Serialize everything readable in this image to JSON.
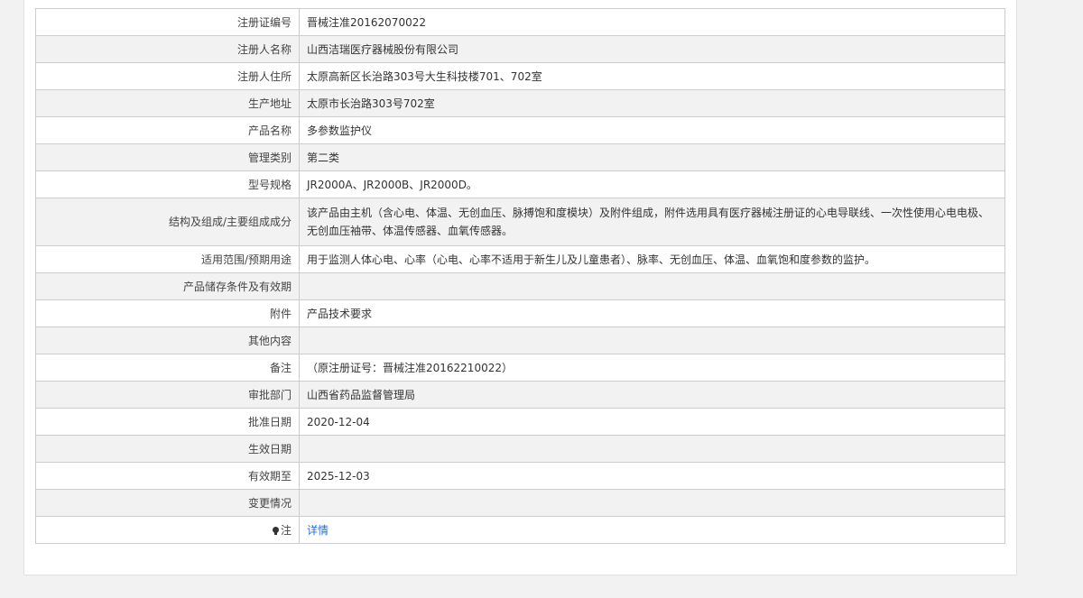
{
  "rows": [
    {
      "label": "注册证编号",
      "value": "晋械注准20162070022"
    },
    {
      "label": "注册人名称",
      "value": "山西洁瑞医疗器械股份有限公司"
    },
    {
      "label": "注册人住所",
      "value": "太原高新区长治路303号大生科技楼701、702室"
    },
    {
      "label": "生产地址",
      "value": "太原市长治路303号702室"
    },
    {
      "label": "产品名称",
      "value": "多参数监护仪"
    },
    {
      "label": "管理类别",
      "value": "第二类"
    },
    {
      "label": "型号规格",
      "value": "JR2000A、JR2000B、JR2000D。"
    },
    {
      "label": "结构及组成/主要组成成分",
      "value": "该产品由主机（含心电、体温、无创血压、脉搏饱和度模块）及附件组成，附件选用具有医疗器械注册证的心电导联线、一次性使用心电电极、无创血压袖带、体温传感器、血氧传感器。"
    },
    {
      "label": "适用范围/预期用途",
      "value": "用于监测人体心电、心率（心电、心率不适用于新生儿及儿童患者）、脉率、无创血压、体温、血氧饱和度参数的监护。"
    },
    {
      "label": "产品储存条件及有效期",
      "value": ""
    },
    {
      "label": "附件",
      "value": "产品技术要求"
    },
    {
      "label": "其他内容",
      "value": ""
    },
    {
      "label": "备注",
      "value": "（原注册证号：晋械注准20162210022）"
    },
    {
      "label": "审批部门",
      "value": "山西省药品监督管理局"
    },
    {
      "label": "批准日期",
      "value": "2020-12-04"
    },
    {
      "label": "生效日期",
      "value": ""
    },
    {
      "label": "有效期至",
      "value": "2025-12-03"
    },
    {
      "label": "变更情况",
      "value": ""
    }
  ],
  "note_row": {
    "label": "注",
    "icon": "bulb-icon",
    "link_text": "详情"
  }
}
